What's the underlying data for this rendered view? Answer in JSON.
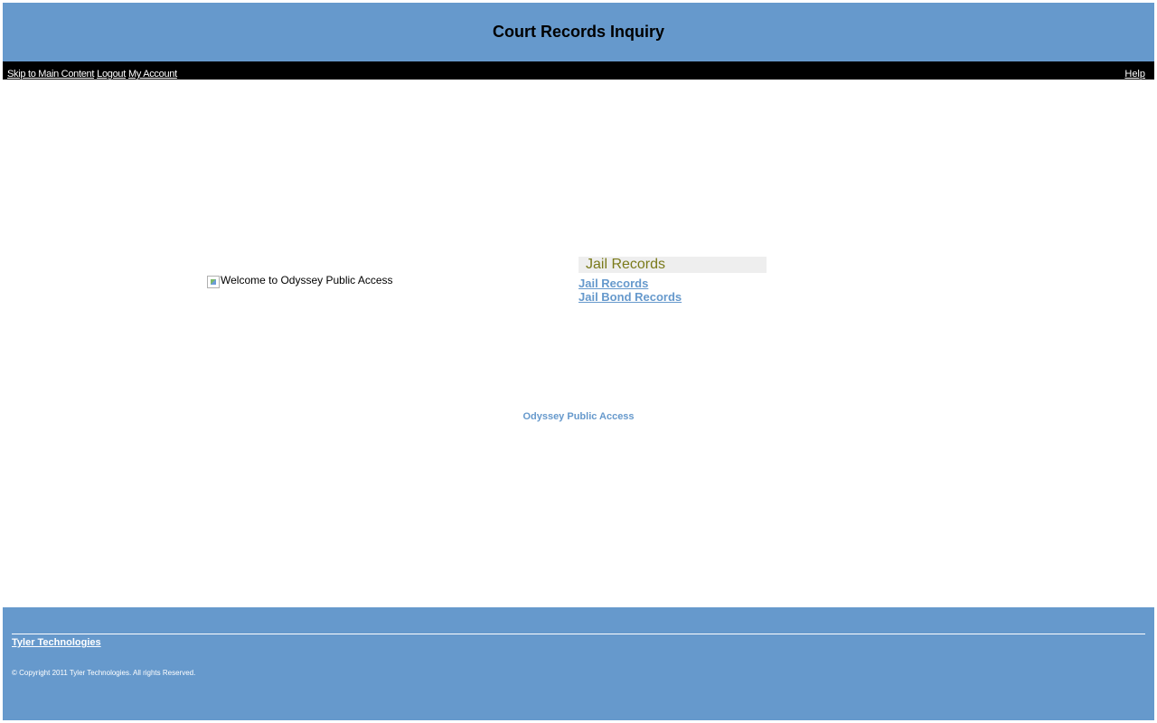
{
  "header": {
    "title": "Court Records Inquiry"
  },
  "nav": {
    "skip_label": "Skip to Main Content",
    "logout_label": "Logout",
    "account_label": "My Account",
    "help_label": "Help"
  },
  "welcome": {
    "image_alt": "Welcome to Odyssey Public Access"
  },
  "panel": {
    "title": "Jail Records",
    "links": [
      {
        "label": "Jail Records"
      },
      {
        "label": "Jail Bond Records"
      }
    ]
  },
  "brand": {
    "label": "Odyssey Public Access"
  },
  "footer": {
    "company_link": "Tyler Technologies",
    "copyright": "© Copyright 2011 Tyler Technologies. All rights Reserved."
  },
  "colors": {
    "header_bg": "#6699cc",
    "navbar_bg": "#000000",
    "link_color": "#6699cc",
    "panel_title_color": "#7a7a1a",
    "panel_title_bg": "#eeeeee"
  }
}
